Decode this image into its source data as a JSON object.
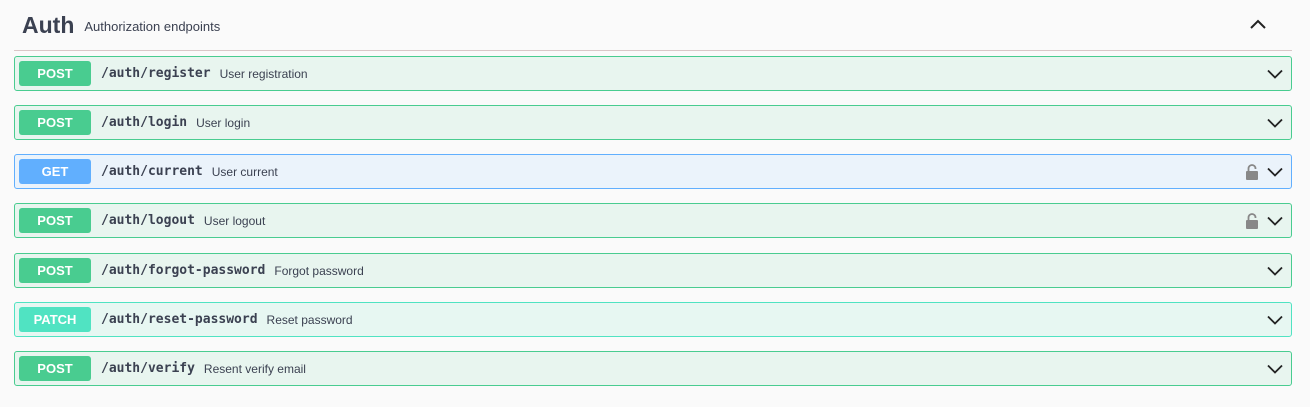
{
  "section": {
    "title": "Auth",
    "description": "Authorization endpoints",
    "icon": "chevron-up-icon"
  },
  "colors": {
    "post": "#49cc90",
    "get": "#61affe",
    "patch": "#50e3c2",
    "text": "#3b4151"
  },
  "operations": [
    {
      "method": "POST",
      "path": "/auth/register",
      "summary": "User registration",
      "locked": false
    },
    {
      "method": "POST",
      "path": "/auth/login",
      "summary": "User login",
      "locked": false
    },
    {
      "method": "GET",
      "path": "/auth/current",
      "summary": "User current",
      "locked": true
    },
    {
      "method": "POST",
      "path": "/auth/logout",
      "summary": "User logout",
      "locked": true
    },
    {
      "method": "POST",
      "path": "/auth/forgot-password",
      "summary": "Forgot password",
      "locked": false
    },
    {
      "method": "PATCH",
      "path": "/auth/reset-password",
      "summary": "Reset password",
      "locked": false
    },
    {
      "method": "POST",
      "path": "/auth/verify",
      "summary": "Resent verify email",
      "locked": false
    }
  ]
}
